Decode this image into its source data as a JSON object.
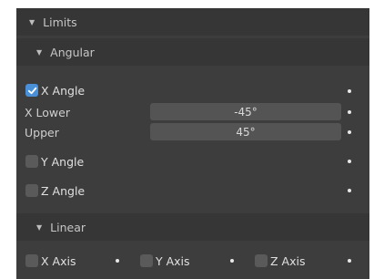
{
  "limits": {
    "header_label": "Limits",
    "angular": {
      "header_label": "Angular",
      "x_angle": {
        "label": "X Angle",
        "checked": true
      },
      "x_lower": {
        "label": "X Lower",
        "value": "-45°"
      },
      "upper": {
        "label": "Upper",
        "value": "45°"
      },
      "y_angle": {
        "label": "Y Angle",
        "checked": false
      },
      "z_angle": {
        "label": "Z Angle",
        "checked": false
      }
    },
    "linear": {
      "header_label": "Linear",
      "x_axis": {
        "label": "X Axis",
        "checked": false
      },
      "y_axis": {
        "label": "Y Axis",
        "checked": false
      },
      "z_axis": {
        "label": "Z Axis",
        "checked": false
      }
    }
  },
  "colors": {
    "panel_bg": "#3d3d3d",
    "header_bg": "#363636",
    "field_bg": "#545454",
    "checkbox_on": "#4a90d9",
    "checkbox_off": "#5a5a5a"
  }
}
